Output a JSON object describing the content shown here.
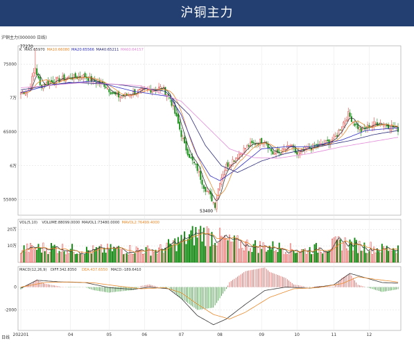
{
  "banner_title": "沪铜主力",
  "window_title": "沪铜主力(000000 日线)",
  "period_label": "日线",
  "colors": {
    "up": "#e0403a",
    "down": "#128a12",
    "ma5": "#333333",
    "ma10": "#e8892a",
    "ma20": "#2b2bc4",
    "ma40": "#2b2b7a",
    "ma60": "#e28ad8",
    "dif": "#333333",
    "dea": "#e8892a"
  },
  "chart_data": [
    {
      "type": "candlestick",
      "panel": "price",
      "legend": [
        "K",
        "MA5:65970",
        "MA10:66080",
        "MA20:65566",
        "MA40:65211",
        "MA60:64157"
      ],
      "y_ticks": [
        {
          "value": 75000,
          "label": "75000"
        },
        {
          "value": 70000,
          "label": "7万"
        },
        {
          "value": 65000,
          "label": "65000"
        },
        {
          "value": 60000,
          "label": "6万"
        },
        {
          "value": 55000,
          "label": "55000"
        }
      ],
      "ylim": [
        52700,
        77700
      ],
      "annotations": [
        {
          "label": "77270",
          "index": 9,
          "value": 77270
        },
        {
          "label": "53400",
          "index": 121,
          "value": 53400
        }
      ],
      "x_ticks": [
        {
          "label": "202201",
          "index": 0
        },
        {
          "label": "04",
          "index": 31
        },
        {
          "label": "05",
          "index": 55
        },
        {
          "label": "06",
          "index": 77
        },
        {
          "label": "07",
          "index": 100
        },
        {
          "label": "08",
          "index": 124
        },
        {
          "label": "09",
          "index": 150
        },
        {
          "label": "10",
          "index": 172
        },
        {
          "label": "11",
          "index": 195
        },
        {
          "label": "12",
          "index": 217
        }
      ],
      "close_anchors": [
        [
          0,
          70800
        ],
        [
          5,
          71200
        ],
        [
          9,
          74500
        ],
        [
          12,
          71800
        ],
        [
          20,
          72500
        ],
        [
          30,
          73000
        ],
        [
          40,
          73200
        ],
        [
          45,
          72500
        ],
        [
          52,
          72000
        ],
        [
          58,
          70500
        ],
        [
          62,
          70200
        ],
        [
          70,
          70800
        ],
        [
          80,
          71200
        ],
        [
          88,
          71500
        ],
        [
          93,
          70000
        ],
        [
          97,
          67000
        ],
        [
          102,
          63000
        ],
        [
          106,
          61000
        ],
        [
          110,
          59500
        ],
        [
          114,
          57000
        ],
        [
          118,
          55500
        ],
        [
          121,
          54200
        ],
        [
          124,
          57800
        ],
        [
          128,
          60000
        ],
        [
          133,
          61000
        ],
        [
          137,
          62000
        ],
        [
          142,
          63000
        ],
        [
          148,
          63500
        ],
        [
          152,
          63800
        ],
        [
          157,
          61800
        ],
        [
          162,
          62000
        ],
        [
          168,
          63000
        ],
        [
          172,
          61700
        ],
        [
          176,
          62200
        ],
        [
          182,
          62800
        ],
        [
          187,
          63000
        ],
        [
          192,
          63600
        ],
        [
          196,
          64200
        ],
        [
          200,
          66000
        ],
        [
          204,
          67600
        ],
        [
          208,
          66200
        ],
        [
          212,
          65200
        ],
        [
          218,
          66000
        ],
        [
          224,
          66400
        ],
        [
          228,
          66000
        ],
        [
          232,
          65800
        ],
        [
          235,
          65400
        ]
      ],
      "ma_anchors": {
        "MA20": [
          [
            0,
            70800
          ],
          [
            20,
            72000
          ],
          [
            45,
            72500
          ],
          [
            70,
            71000
          ],
          [
            93,
            70200
          ],
          [
            100,
            67500
          ],
          [
            110,
            61500
          ],
          [
            118,
            58500
          ],
          [
            124,
            57800
          ],
          [
            135,
            59600
          ],
          [
            150,
            62500
          ],
          [
            165,
            62800
          ],
          [
            180,
            62800
          ],
          [
            200,
            63800
          ],
          [
            215,
            65200
          ],
          [
            235,
            65600
          ]
        ],
        "MA40": [
          [
            0,
            71200
          ],
          [
            30,
            72300
          ],
          [
            60,
            72000
          ],
          [
            90,
            71000
          ],
          [
            105,
            67500
          ],
          [
            115,
            63000
          ],
          [
            125,
            60000
          ],
          [
            135,
            59000
          ],
          [
            150,
            60700
          ],
          [
            165,
            61800
          ],
          [
            185,
            62800
          ],
          [
            205,
            63700
          ],
          [
            220,
            64600
          ],
          [
            235,
            65200
          ]
        ],
        "MA60": [
          [
            0,
            71500
          ],
          [
            40,
            72300
          ],
          [
            75,
            71800
          ],
          [
            100,
            69500
          ],
          [
            115,
            66000
          ],
          [
            130,
            62500
          ],
          [
            145,
            61200
          ],
          [
            160,
            61100
          ],
          [
            180,
            61800
          ],
          [
            200,
            62800
          ],
          [
            220,
            63600
          ],
          [
            235,
            64200
          ]
        ]
      }
    },
    {
      "type": "bar",
      "panel": "volume",
      "legend": [
        "VOL(5,10)",
        "VOLUME:88099.0000",
        "MAVOL1:73480.0000",
        "MAVOL2:76499.4000"
      ],
      "y_ticks": [
        {
          "value": 200000,
          "label": "20万"
        },
        {
          "value": 100000,
          "label": "10万"
        }
      ],
      "ylim": [
        0,
        260000
      ],
      "volume_anchors": [
        [
          0,
          80000
        ],
        [
          20,
          90000
        ],
        [
          40,
          70000
        ],
        [
          60,
          80000
        ],
        [
          85,
          70000
        ],
        [
          95,
          110000
        ],
        [
          105,
          150000
        ],
        [
          112,
          180000
        ],
        [
          120,
          160000
        ],
        [
          130,
          120000
        ],
        [
          145,
          100000
        ],
        [
          160,
          90000
        ],
        [
          175,
          70000
        ],
        [
          190,
          90000
        ],
        [
          200,
          120000
        ],
        [
          210,
          100000
        ],
        [
          225,
          80000
        ],
        [
          235,
          88099
        ]
      ]
    },
    {
      "type": "line",
      "panel": "macd",
      "legend": [
        "MACD(12,26,9)",
        "DIFF:342.8350",
        "DEA:437.6550",
        "MACD:-189.6410"
      ],
      "y_ticks": [
        {
          "value": 0,
          "label": "0"
        },
        {
          "value": -2000,
          "label": "-2000"
        }
      ],
      "ylim": [
        -3800,
        1800
      ],
      "dif_anchors": [
        [
          0,
          -100
        ],
        [
          10,
          600
        ],
        [
          25,
          450
        ],
        [
          40,
          400
        ],
        [
          55,
          -50
        ],
        [
          70,
          -200
        ],
        [
          80,
          0
        ],
        [
          92,
          -150
        ],
        [
          100,
          -1000
        ],
        [
          110,
          -2500
        ],
        [
          120,
          -3300
        ],
        [
          128,
          -2800
        ],
        [
          140,
          -1500
        ],
        [
          152,
          -300
        ],
        [
          165,
          0
        ],
        [
          180,
          -100
        ],
        [
          195,
          200
        ],
        [
          205,
          1200
        ],
        [
          215,
          800
        ],
        [
          225,
          400
        ],
        [
          235,
          342.835
        ]
      ],
      "dea_anchors": [
        [
          0,
          0
        ],
        [
          15,
          400
        ],
        [
          30,
          450
        ],
        [
          45,
          380
        ],
        [
          60,
          100
        ],
        [
          75,
          -150
        ],
        [
          90,
          -50
        ],
        [
          100,
          -500
        ],
        [
          110,
          -1500
        ],
        [
          120,
          -2400
        ],
        [
          130,
          -2800
        ],
        [
          140,
          -2200
        ],
        [
          155,
          -900
        ],
        [
          170,
          -150
        ],
        [
          185,
          -50
        ],
        [
          200,
          300
        ],
        [
          210,
          900
        ],
        [
          220,
          700
        ],
        [
          235,
          437.655
        ]
      ]
    }
  ]
}
